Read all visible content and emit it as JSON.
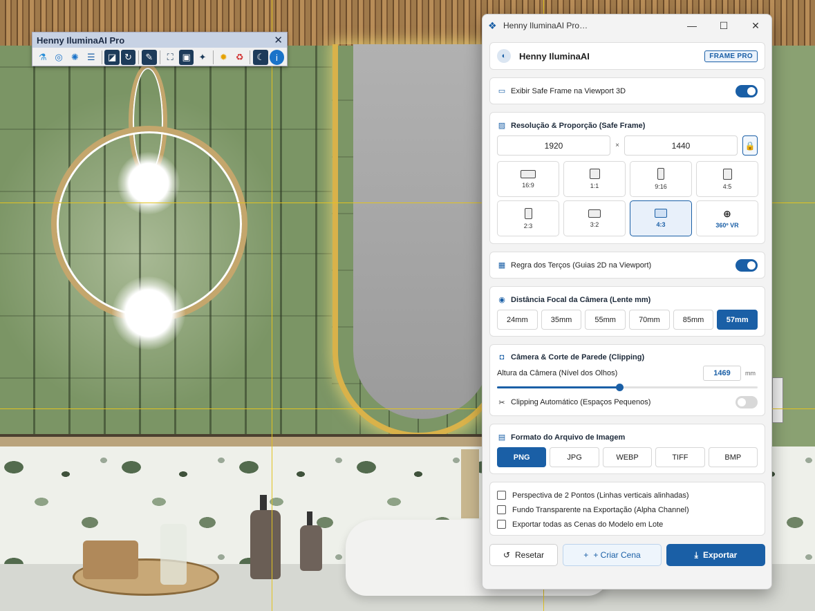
{
  "toolbar": {
    "title": "Henny IluminaAI Pro",
    "icons": [
      "flask-icon",
      "eye-icon",
      "sun-icon",
      "sliders-icon",
      "render-icon",
      "rotate-icon",
      "edit-icon",
      "frame-icon",
      "scene-icon",
      "sparkle-icon",
      "bulb-icon",
      "trash-icon",
      "moon-icon",
      "info-icon"
    ]
  },
  "dialog": {
    "window_title": "Henny IluminaAI Pro — Enquadramento & Câ…",
    "header": {
      "name": "Henny IluminaAI",
      "badge": "FRAME PRO"
    },
    "safe_frame": {
      "label": "Exibir Safe Frame na Viewport 3D",
      "enabled": true
    },
    "resolution": {
      "title": "Resolução & Proporção (Safe Frame)",
      "width": "1920",
      "height": "1440",
      "separator": "×",
      "ratios": [
        {
          "label": "16:9",
          "active": false
        },
        {
          "label": "1:1",
          "active": false
        },
        {
          "label": "9:16",
          "active": false
        },
        {
          "label": "4:5",
          "active": false
        },
        {
          "label": "2:3",
          "active": false
        },
        {
          "label": "3:2",
          "active": false
        },
        {
          "label": "4:3",
          "active": true
        },
        {
          "label": "360º VR",
          "active": false
        }
      ]
    },
    "thirds": {
      "label": "Regra dos Terços (Guias 2D na Viewport)",
      "enabled": true
    },
    "focal": {
      "title": "Distância Focal da Câmera (Lente mm)",
      "options": [
        "24mm",
        "35mm",
        "55mm",
        "70mm",
        "85mm",
        "57mm"
      ],
      "selected": "57mm"
    },
    "camera": {
      "title": "Câmera & Corte de Parede (Clipping)",
      "height_label": "Altura da Câmera (Nível dos Olhos)",
      "height_value": "1469",
      "unit": "mm",
      "slider_fraction": 0.47,
      "clipping_label": "Clipping Automático (Espaços Pequenos)",
      "clipping_enabled": false
    },
    "format": {
      "title": "Formato do Arquivo de Imagem",
      "options": [
        "PNG",
        "JPG",
        "WEBP",
        "TIFF",
        "BMP"
      ],
      "selected": "PNG"
    },
    "options": [
      {
        "label": "Perspectiva de 2 Pontos (Linhas verticais alinhadas)",
        "checked": false
      },
      {
        "label": "Fundo Transparente na Exportação (Alpha Channel)",
        "checked": false
      },
      {
        "label": "Exportar todas as Cenas do Modelo em Lote",
        "checked": false
      }
    ],
    "buttons": {
      "reset": "Resetar",
      "create": "+ Criar Cena",
      "export": "Exportar"
    }
  },
  "colors": {
    "accent": "#1a5fa6",
    "guide": "#e2c320",
    "wall": "#7b9565"
  }
}
